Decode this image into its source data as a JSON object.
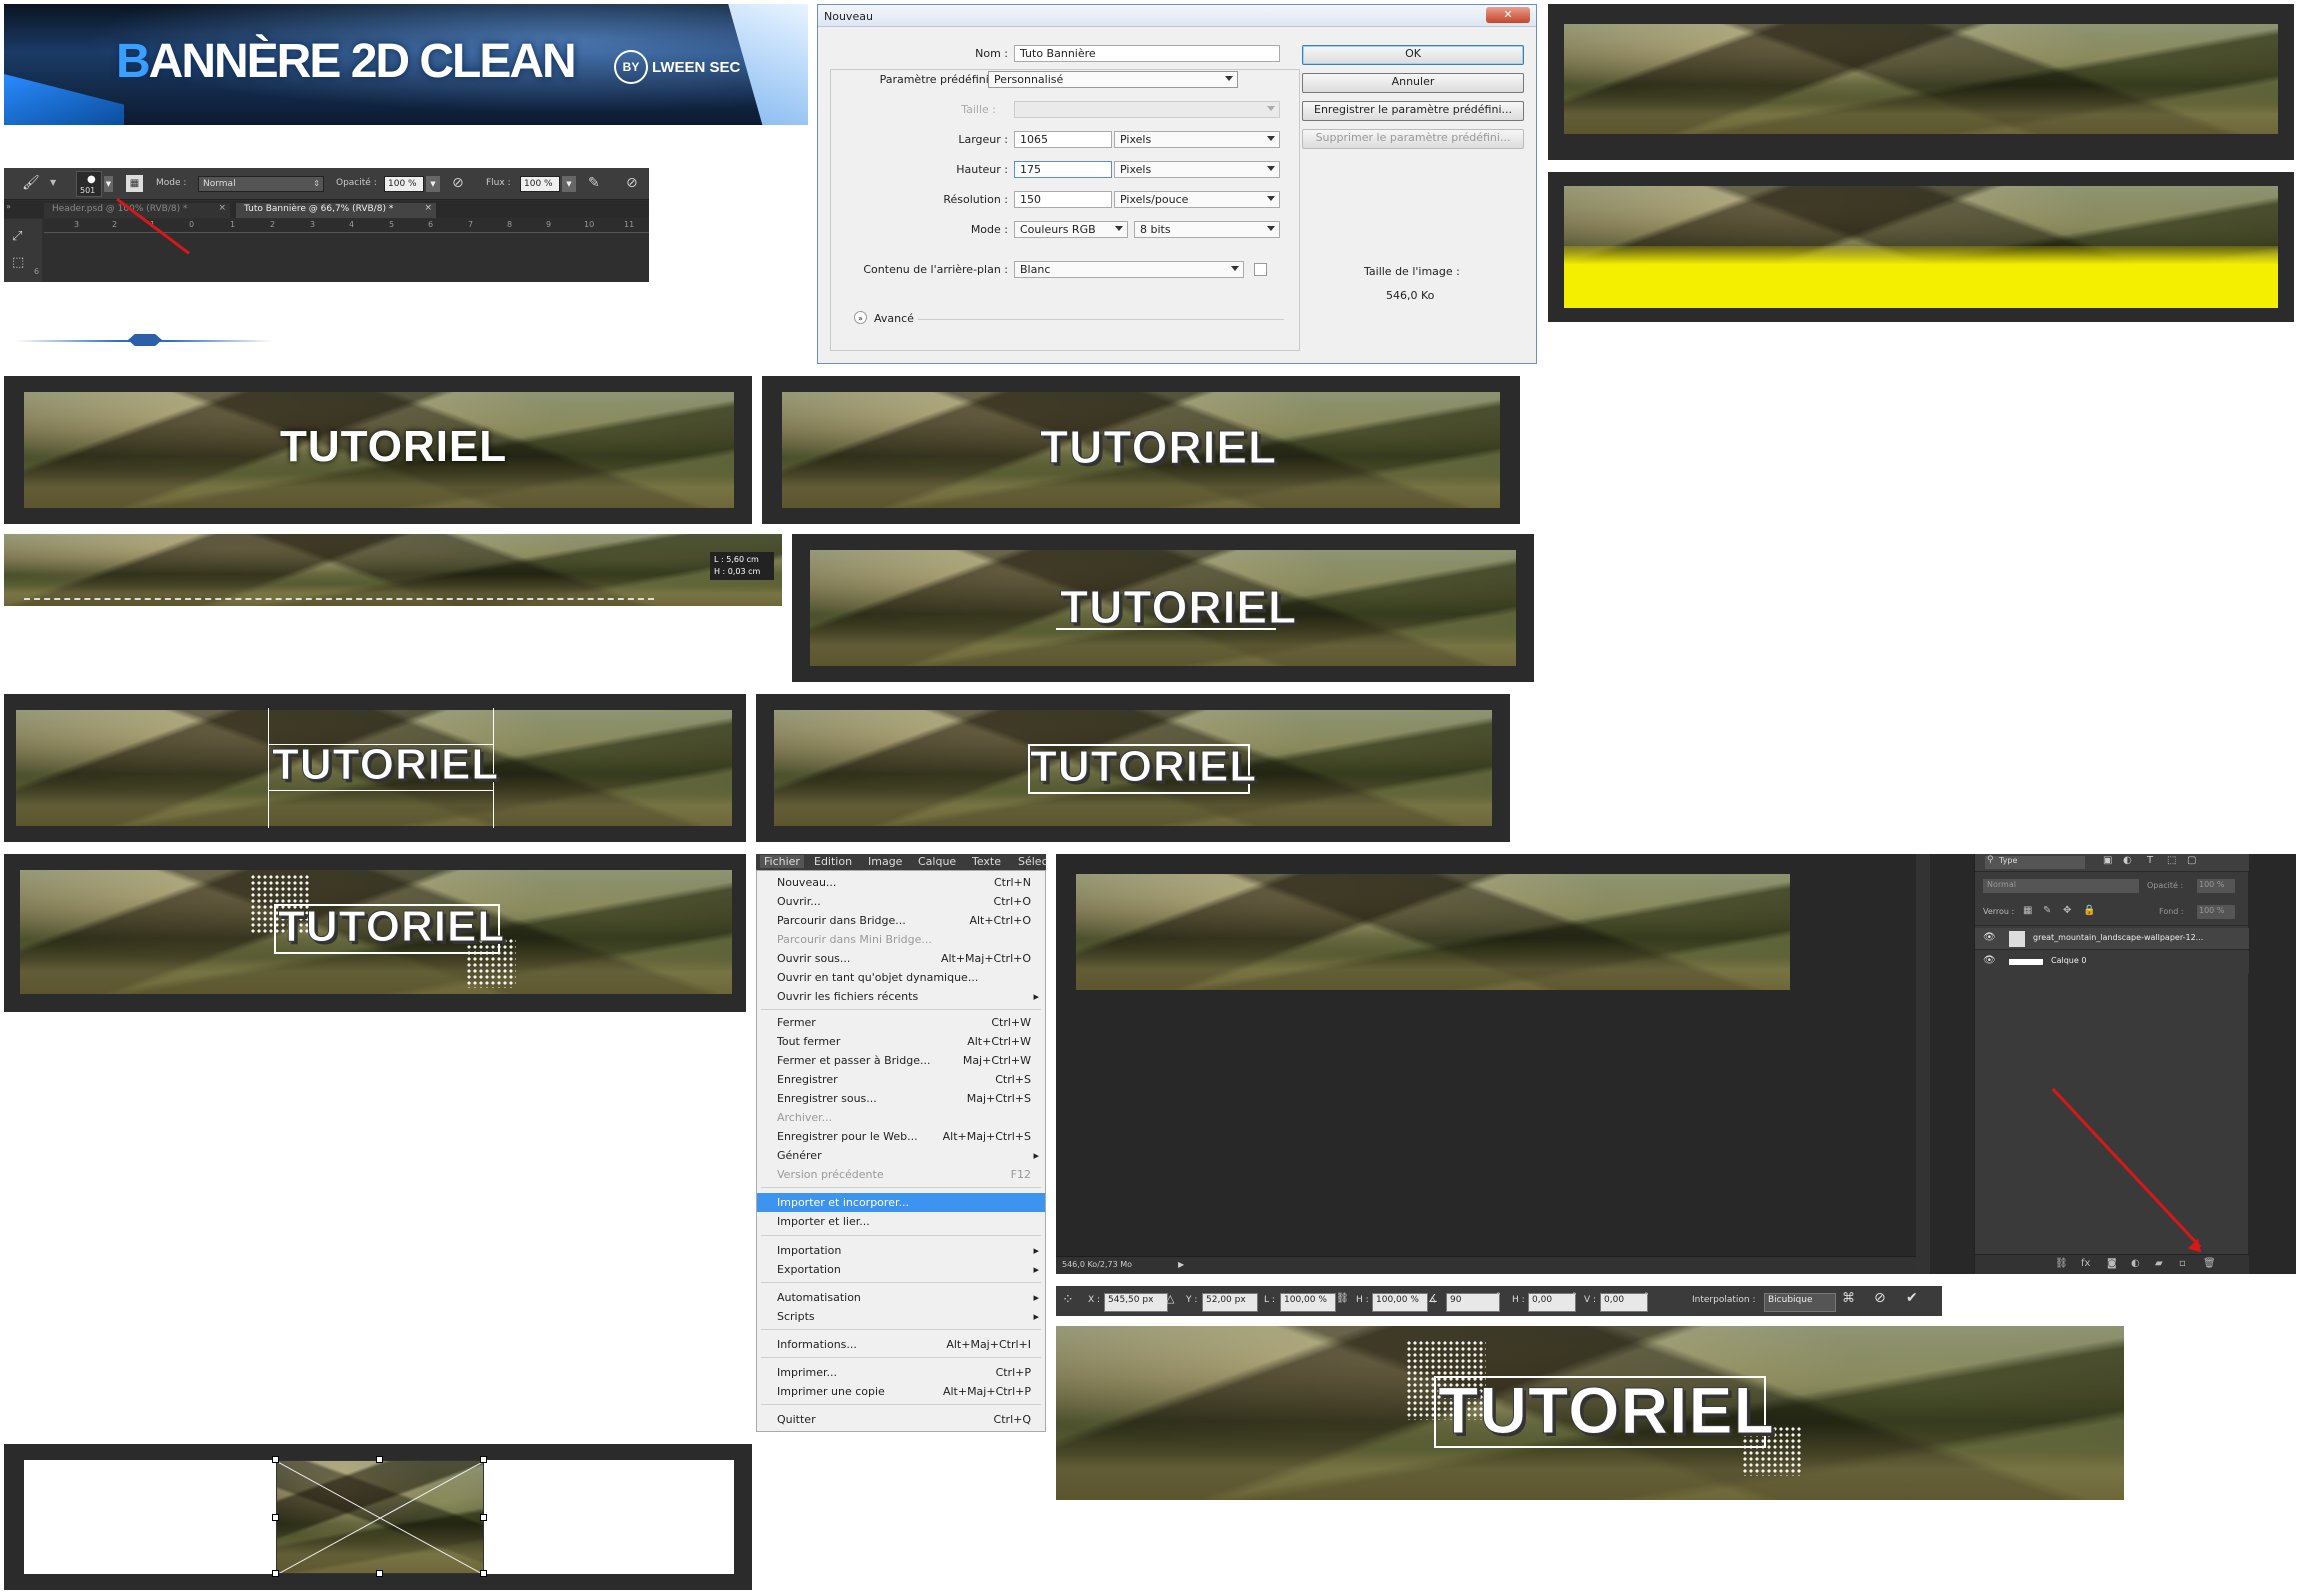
{
  "banner_header": {
    "title_b": "B",
    "title_rest": "ANNÈRE 2D CLEAN",
    "by_label": "BY",
    "author": "LWEEN SEC"
  },
  "brush_toolbar": {
    "brush_size": "501",
    "mode_label": "Mode :",
    "mode_value": "Normal",
    "opacity_label": "Opacité :",
    "opacity_value": "100 %",
    "flow_label": "Flux :",
    "flow_value": "100 %",
    "tabs": [
      {
        "label": "Header.psd @ 100% (RVB/8) *"
      },
      {
        "label": "Tuto Bannière @ 66,7% (RVB/8) *"
      }
    ],
    "ruler_marks": [
      "3",
      "2",
      "1",
      "0",
      "1",
      "2",
      "3",
      "4",
      "5",
      "6",
      "7",
      "8",
      "9",
      "10",
      "11"
    ],
    "ruler_side": "6"
  },
  "new_dialog": {
    "title": "Nouveau",
    "name_label": "Nom :",
    "name_value": "Tuto Bannière",
    "preset_label": "Paramètre prédéfini :",
    "preset_value": "Personnalisé",
    "size_label": "Taille :",
    "width_label": "Largeur :",
    "width_value": "1065",
    "width_unit": "Pixels",
    "height_label": "Hauteur :",
    "height_value": "175",
    "height_unit": "Pixels",
    "resolution_label": "Résolution :",
    "resolution_value": "150",
    "resolution_unit": "Pixels/pouce",
    "mode_label": "Mode :",
    "mode_value": "Couleurs RGB",
    "bits_value": "8 bits",
    "background_label": "Contenu de l'arrière-plan :",
    "background_value": "Blanc",
    "advanced_label": "Avancé",
    "ok_label": "OK",
    "cancel_label": "Annuler",
    "save_preset_label": "Enregistrer le paramètre prédéfini...",
    "delete_preset_label": "Supprimer le paramètre prédéfini...",
    "image_size_label": "Taille de l'image :",
    "image_size_value": "546,0 Ko",
    "close_symbol": "✕"
  },
  "tutorial_text": "TUTORIEL",
  "measure_tooltip": {
    "l": "L : 5,60 cm",
    "h": "H : 0,03 cm"
  },
  "file_menu": {
    "menubar": [
      "Fichier",
      "Edition",
      "Image",
      "Calque",
      "Texte",
      "Sélec"
    ],
    "items": [
      {
        "label": "Nouveau...",
        "shortcut": "Ctrl+N"
      },
      {
        "label": "Ouvrir...",
        "shortcut": "Ctrl+O"
      },
      {
        "label": "Parcourir dans Bridge...",
        "shortcut": "Alt+Ctrl+O"
      },
      {
        "label": "Parcourir dans Mini Bridge...",
        "shortcut": ""
      },
      {
        "label": "Ouvrir sous...",
        "shortcut": "Alt+Maj+Ctrl+O"
      },
      {
        "label": "Ouvrir en tant qu'objet dynamique...",
        "shortcut": ""
      },
      {
        "label": "Ouvrir les fichiers récents",
        "shortcut": ""
      },
      {
        "label": "Fermer",
        "shortcut": "Ctrl+W"
      },
      {
        "label": "Tout fermer",
        "shortcut": "Alt+Ctrl+W"
      },
      {
        "label": "Fermer et passer à Bridge...",
        "shortcut": "Maj+Ctrl+W"
      },
      {
        "label": "Enregistrer",
        "shortcut": "Ctrl+S"
      },
      {
        "label": "Enregistrer sous...",
        "shortcut": "Maj+Ctrl+S"
      },
      {
        "label": "Archiver...",
        "shortcut": ""
      },
      {
        "label": "Enregistrer pour le Web...",
        "shortcut": "Alt+Maj+Ctrl+S"
      },
      {
        "label": "Générer",
        "shortcut": ""
      },
      {
        "label": "Version précédente",
        "shortcut": "F12"
      },
      {
        "label": "Importer et incorporer...",
        "shortcut": ""
      },
      {
        "label": "Importer et lier...",
        "shortcut": ""
      },
      {
        "label": "Importation",
        "shortcut": ""
      },
      {
        "label": "Exportation",
        "shortcut": ""
      },
      {
        "label": "Automatisation",
        "shortcut": ""
      },
      {
        "label": "Scripts",
        "shortcut": ""
      },
      {
        "label": "Informations...",
        "shortcut": "Alt+Maj+Ctrl+I"
      },
      {
        "label": "Imprimer...",
        "shortcut": "Ctrl+P"
      },
      {
        "label": "Imprimer une copie",
        "shortcut": "Alt+Maj+Ctrl+P"
      },
      {
        "label": "Quitter",
        "shortcut": "Ctrl+Q"
      }
    ]
  },
  "layers_panel": {
    "kind_label": "Type",
    "blend_mode": "Normal",
    "opacity_label": "Opacité :",
    "opacity_value": "100 %",
    "lock_label": "Verrou :",
    "fill_label": "Fond :",
    "fill_value": "100 %",
    "layers": [
      {
        "name": "great_mountain_landscape-wallpaper-12..."
      },
      {
        "name": "Calque 0"
      }
    ],
    "status": "546,0 Ko/2,73 Mo"
  },
  "transform_bar": {
    "x_label": "X :",
    "x_value": "545,50 px",
    "y_label": "Y :",
    "y_value": "52,00 px",
    "w_label": "L :",
    "w_value": "100,00 %",
    "h_label": "H :",
    "h_value": "100,00 %",
    "angle_value": "90",
    "hskew_label": "H :",
    "hskew_value": "0,00",
    "vskew_label": "V :",
    "vskew_value": "0,00",
    "interp_label": "Interpolation :",
    "interp_value": "Bicubique"
  },
  "colors": {
    "frame": "#2b2b2b",
    "yellow": "#f4ee00",
    "menu_highlight": "#3d93f0",
    "banner_blue": "#1d7fd6"
  }
}
